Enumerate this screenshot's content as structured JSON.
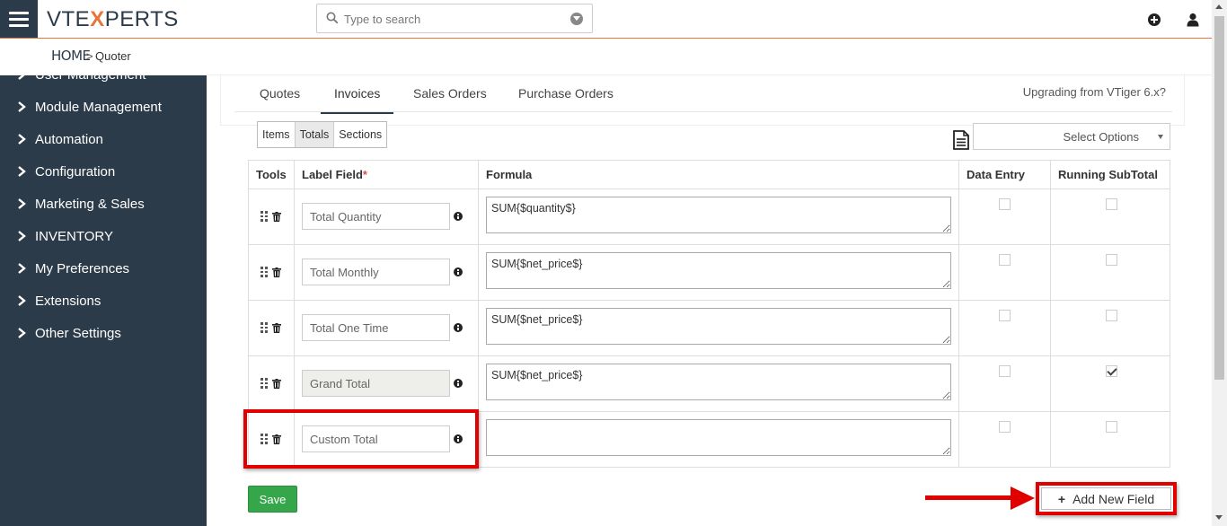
{
  "header": {
    "logo_part1": "VTE",
    "logo_x": "X",
    "logo_part2": "PERTS",
    "search_placeholder": "Type to search"
  },
  "breadcrumb": {
    "home": "HOME",
    "separator": ">",
    "current": "Quoter"
  },
  "sidebar": {
    "items": [
      {
        "label": "User Management"
      },
      {
        "label": "Module Management"
      },
      {
        "label": "Automation"
      },
      {
        "label": "Configuration"
      },
      {
        "label": "Marketing & Sales"
      },
      {
        "label": "INVENTORY"
      },
      {
        "label": "My Preferences"
      },
      {
        "label": "Extensions"
      },
      {
        "label": "Other Settings"
      }
    ]
  },
  "tabs": [
    {
      "label": "Quotes",
      "active": false
    },
    {
      "label": "Invoices",
      "active": true
    },
    {
      "label": "Sales Orders",
      "active": false
    },
    {
      "label": "Purchase Orders",
      "active": false
    }
  ],
  "upgrade_link": "Upgrading from VTiger 6.x?",
  "subtabs": [
    {
      "label": "Items",
      "active": false
    },
    {
      "label": "Totals",
      "active": true
    },
    {
      "label": "Sections",
      "active": false
    }
  ],
  "select_options": "Select Options",
  "table": {
    "headers": {
      "tools": "Tools",
      "label_field": "Label Field",
      "required_mark": "*",
      "formula": "Formula",
      "data_entry": "Data Entry",
      "running_subtotal": "Running SubTotal"
    },
    "rows": [
      {
        "label": "Total Quantity",
        "formula": "SUM{$quantity$}",
        "disabled": false,
        "data_entry": false,
        "running_subtotal": false
      },
      {
        "label": "Total Monthly",
        "formula": "SUM{$net_price$}",
        "disabled": false,
        "data_entry": false,
        "running_subtotal": false
      },
      {
        "label": "Total One Time",
        "formula": "SUM{$net_price$}",
        "disabled": false,
        "data_entry": false,
        "running_subtotal": false
      },
      {
        "label": "Grand Total",
        "formula": "SUM{$net_price$}",
        "disabled": true,
        "data_entry": false,
        "running_subtotal": true
      },
      {
        "label": "Custom Total",
        "formula": "",
        "disabled": false,
        "data_entry": false,
        "running_subtotal": false
      }
    ]
  },
  "buttons": {
    "save": "Save",
    "add_new_field": "Add New Field",
    "add_plus": "+"
  },
  "colors": {
    "sidebar_bg": "#2c3b49",
    "accent": "#e8743b",
    "save_green": "#35a74a",
    "highlight_red": "#e00000"
  }
}
